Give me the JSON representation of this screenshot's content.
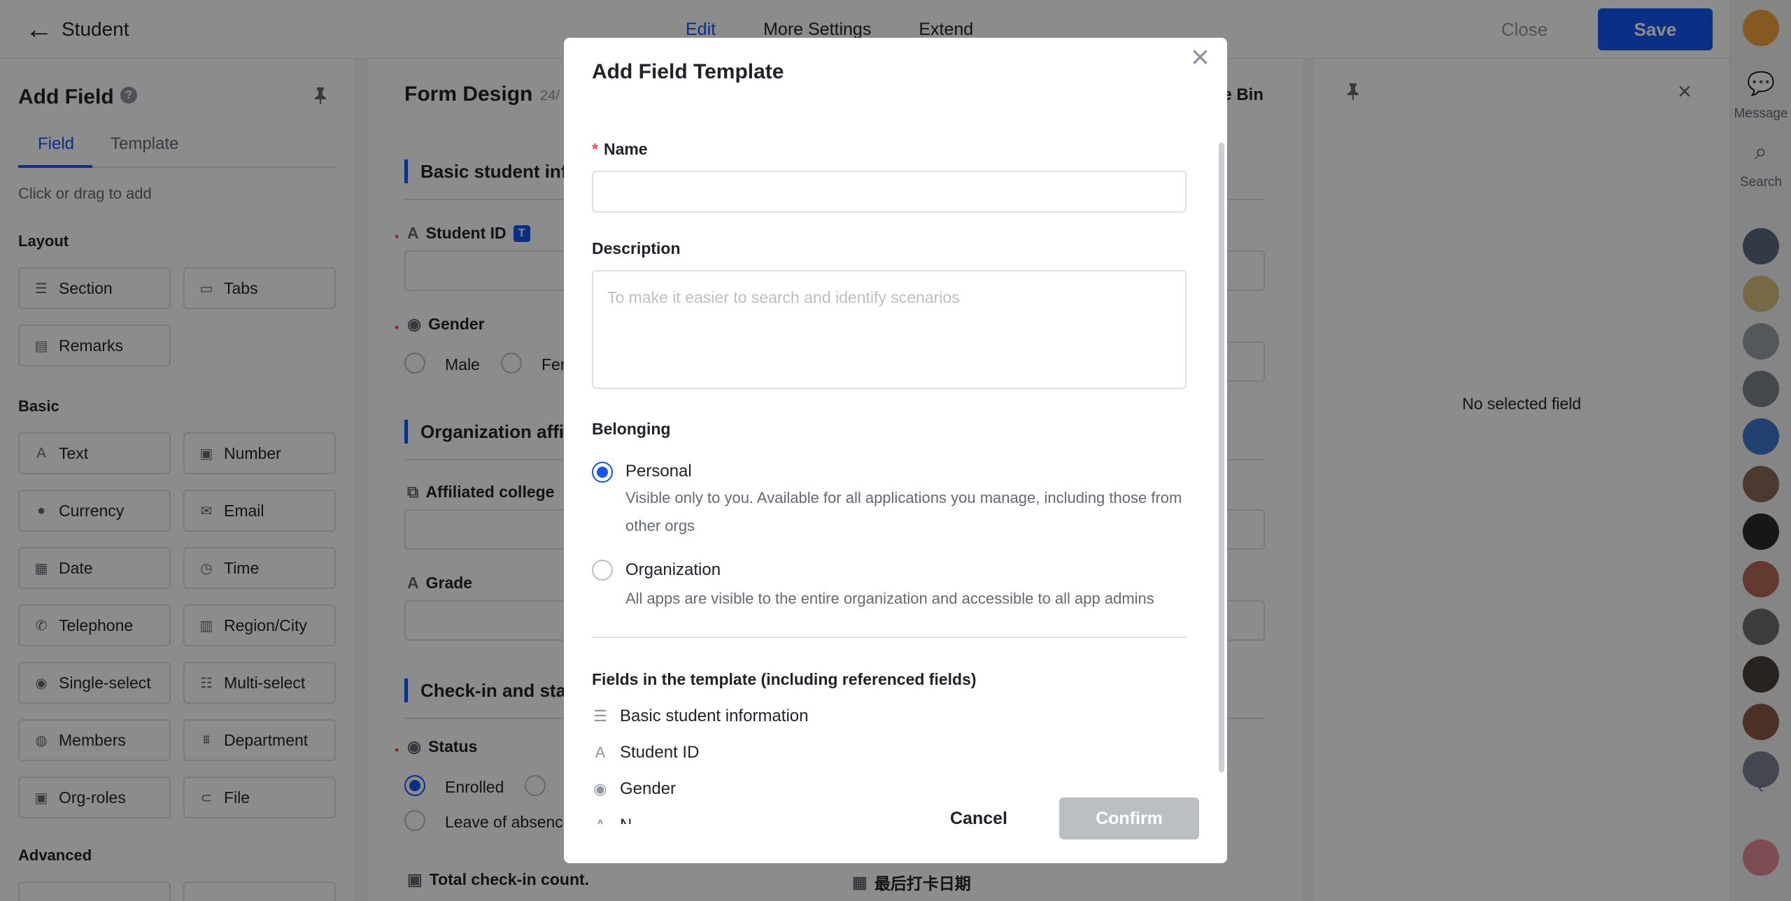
{
  "colors": {
    "accent": "#1456f0",
    "required": "#f54a45",
    "disabled": "#bbbfc4",
    "overlay": "rgba(0,0,0,0.45)"
  },
  "header": {
    "title": "Student",
    "tabs": [
      "Edit",
      "More Settings",
      "Extend"
    ],
    "active_tab": "Edit",
    "close_label": "Close",
    "save_label": "Save"
  },
  "left_panel": {
    "title": "Add Field",
    "tabs": [
      "Field",
      "Template"
    ],
    "hint": "Click or drag to add",
    "layout_label": "Layout",
    "layout_items": [
      "Section",
      "Tabs",
      "Remarks"
    ],
    "basic_label": "Basic",
    "basic_items": [
      "Text",
      "Number",
      "Currency",
      "Email",
      "Date",
      "Time",
      "Telephone",
      "Region/City",
      "Single-select",
      "Multi-select",
      "Members",
      "Department",
      "Org-roles",
      "File"
    ],
    "advanced_label": "Advanced"
  },
  "form": {
    "title": "Form Design",
    "count": "24/",
    "recycle_bin": "e Bin",
    "sections": [
      "Basic student inf",
      "Organization affil",
      "Check-in and stat"
    ],
    "student_id_label": "Student ID",
    "student_id_badge": "T",
    "gender_label": "Gender",
    "gender_options": [
      "Male",
      "Fer"
    ],
    "affiliated_college_label": "Affiliated college",
    "grade_label": "Grade",
    "status_label": "Status",
    "status_options": [
      "Enrolled",
      "Leave of absence"
    ],
    "total_checkin_label": "Total check-in count.",
    "last_checkin_label": "最后打卡日期"
  },
  "right_panel": {
    "empty_text": "No selected field"
  },
  "rail": {
    "message_label": "Message",
    "search_label": "Search"
  },
  "modal": {
    "title": "Add Field Template",
    "name_label": "Name",
    "name_value": "",
    "description_label": "Description",
    "description_placeholder": "To make it easier to search and identify scenarios",
    "belonging_label": "Belonging",
    "options": [
      {
        "title": "Personal",
        "desc": "Visible only to you. Available for all applications you manage, including those from other orgs",
        "selected": true
      },
      {
        "title": "Organization",
        "desc": "All apps are visible to the entire organization and accessible to all app admins",
        "selected": false
      }
    ],
    "fields_label": "Fields in the template (including referenced fields)",
    "fields": [
      "Basic student information",
      "Student ID",
      "Gender",
      "N"
    ],
    "cancel_label": "Cancel",
    "confirm_label": "Confirm"
  }
}
